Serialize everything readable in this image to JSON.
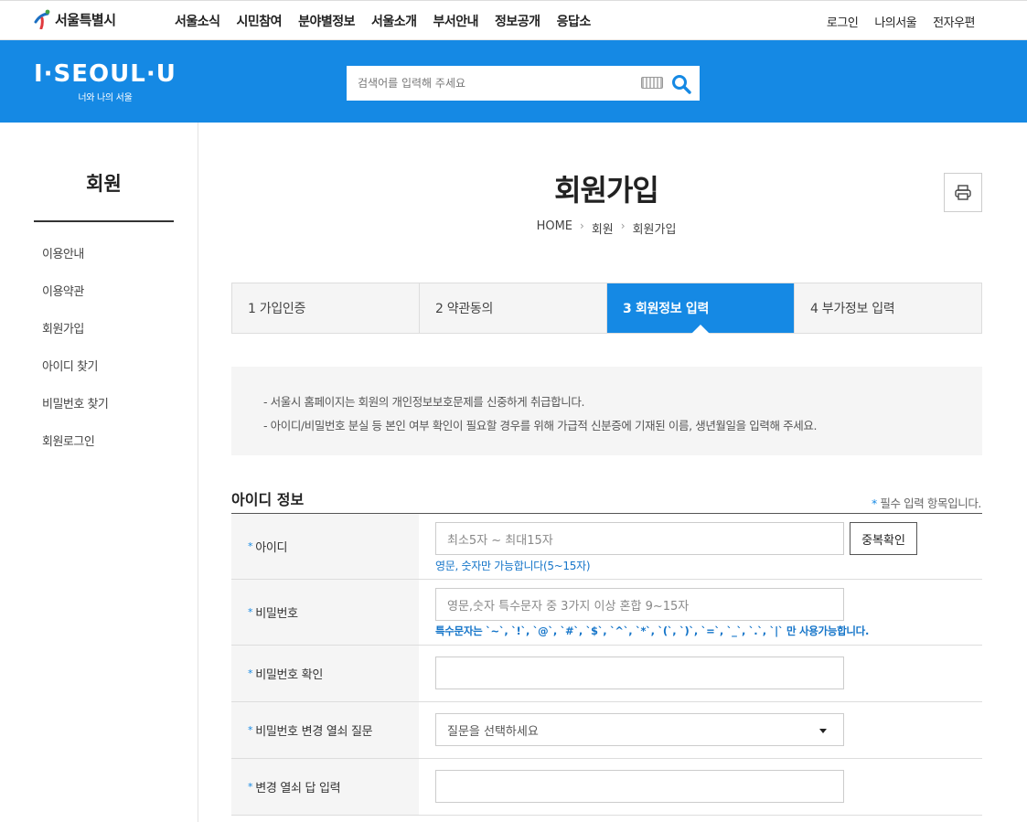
{
  "top": {
    "logo_text": "서울특별시",
    "gnb": [
      "서울소식",
      "시민참여",
      "분야별정보",
      "서울소개",
      "부서안내",
      "정보공개",
      "응답소"
    ],
    "util": [
      "로그인",
      "나의서울",
      "전자우편"
    ]
  },
  "header": {
    "brand": "I·SEOUL·U",
    "brand_sub": "너와 나의 서울",
    "search_placeholder": "검색어를 입력해 주세요",
    "color": "#1589e4"
  },
  "sidebar": {
    "title": "회원",
    "items": [
      "이용안내",
      "이용약관",
      "회원가입",
      "아이디 찾기",
      "비밀번호 찾기",
      "회원로그인"
    ]
  },
  "page": {
    "title": "회원가입",
    "breadcrumb": [
      "HOME",
      "회원",
      "회원가입"
    ]
  },
  "steps": [
    "1 가입인증",
    "2 약관동의",
    "3 회원정보 입력",
    "4 부가정보 입력"
  ],
  "notice": [
    "- 서울시 홈페이지는 회원의 개인정보보호문제를 신중하게 취급합니다.",
    "- 아이디/비밀번호 분실 등 본인 여부 확인이 필요할 경우를 위해 가급적 신분증에 기재된 이름, 생년월일을 입력해 주세요."
  ],
  "section": {
    "title": "아이디 정보",
    "required_note": "필수 입력 항목입니다."
  },
  "form": {
    "id": {
      "label": "아이디",
      "placeholder": "최소5자 ~ 최대15자",
      "hint": "영문, 숫자만 가능합니다(5~15자)",
      "button": "중복확인"
    },
    "password": {
      "label": "비밀번호",
      "placeholder": "영문,숫자 특수문자 중 3가지 이상 혼합 9~15자",
      "hint": "특수문자는 `~`, `!`, `@`, `#`, `$`, `^`, `*`, `(`, `)`, `=`, `_`, `.`, `|` 만 사용가능합니다."
    },
    "password_confirm": {
      "label": "비밀번호 확인",
      "value": ""
    },
    "question": {
      "label": "비밀번호 변경 열쇠 질문",
      "selected": "질문을 선택하세요"
    },
    "answer": {
      "label": "변경 열쇠 답 입력",
      "value": ""
    }
  }
}
